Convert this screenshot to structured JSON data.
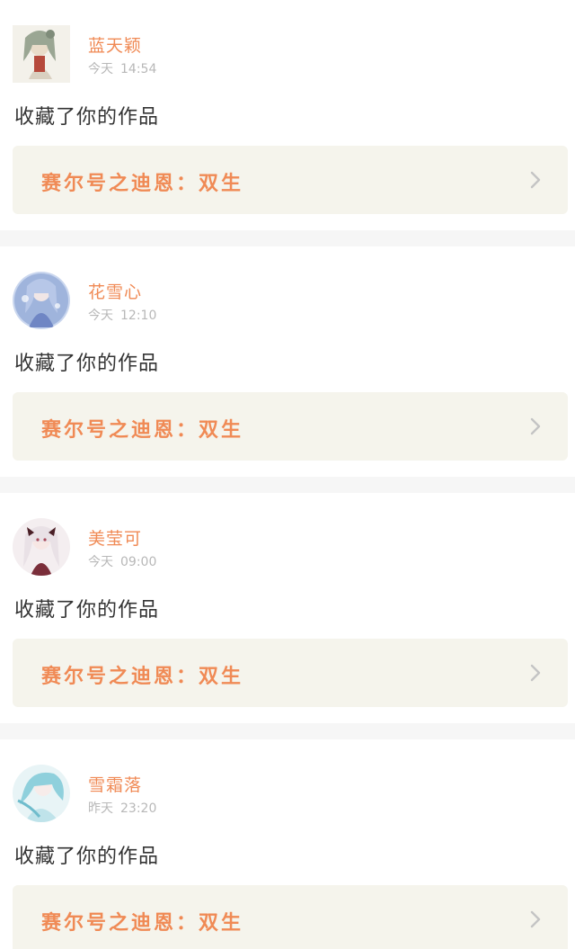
{
  "feed": {
    "items": [
      {
        "username": "蓝天颖",
        "day": "今天",
        "time": "14:54",
        "action": "收藏了你的作品",
        "work_title": "赛尔号之迪恩：双生",
        "avatar_icon": "anime-avatar-icon"
      },
      {
        "username": "花雪心",
        "day": "今天",
        "time": "12:10",
        "action": "收藏了你的作品",
        "work_title": "赛尔号之迪恩：双生",
        "avatar_icon": "anime-avatar-icon"
      },
      {
        "username": "美莹可",
        "day": "今天",
        "time": "09:00",
        "action": "收藏了你的作品",
        "work_title": "赛尔号之迪恩：双生",
        "avatar_icon": "anime-avatar-icon"
      },
      {
        "username": "雪霜落",
        "day": "昨天",
        "time": "23:20",
        "action": "收藏了你的作品",
        "work_title": "赛尔号之迪恩：双生",
        "avatar_icon": "anime-avatar-icon"
      }
    ]
  },
  "colors": {
    "accent": "#f08a55",
    "card_bg": "#ffffff",
    "link_bg": "#f5f4ec",
    "page_bg": "#f6f6f6",
    "muted": "#b8b8b8",
    "text": "#333333"
  }
}
